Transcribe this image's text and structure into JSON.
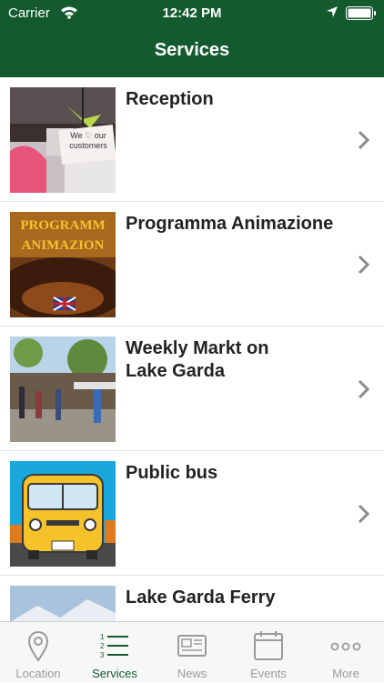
{
  "status_bar": {
    "carrier": "Carrier",
    "time": "12:42 PM"
  },
  "header": {
    "title": "Services"
  },
  "services": [
    {
      "title": "Reception",
      "image_text": "We ♡ our customers"
    },
    {
      "title": "Programma Animazione",
      "image_text": "PROGRAMM ANIMAZION"
    },
    {
      "title": "Weekly Markt on Lake Garda"
    },
    {
      "title": "Public bus"
    },
    {
      "title": "Lake Garda Ferry"
    }
  ],
  "tabbar": {
    "active": "Services",
    "tabs": [
      {
        "label": "Location",
        "icon": "map-pin-icon"
      },
      {
        "label": "Services",
        "icon": "numbered-list-icon"
      },
      {
        "label": "News",
        "icon": "newspaper-icon"
      },
      {
        "label": "Events",
        "icon": "calendar-icon"
      },
      {
        "label": "More",
        "icon": "more-dots-icon"
      }
    ]
  },
  "colors": {
    "brand_green": "#135a2f",
    "inactive_gray": "#9a9a9a"
  }
}
